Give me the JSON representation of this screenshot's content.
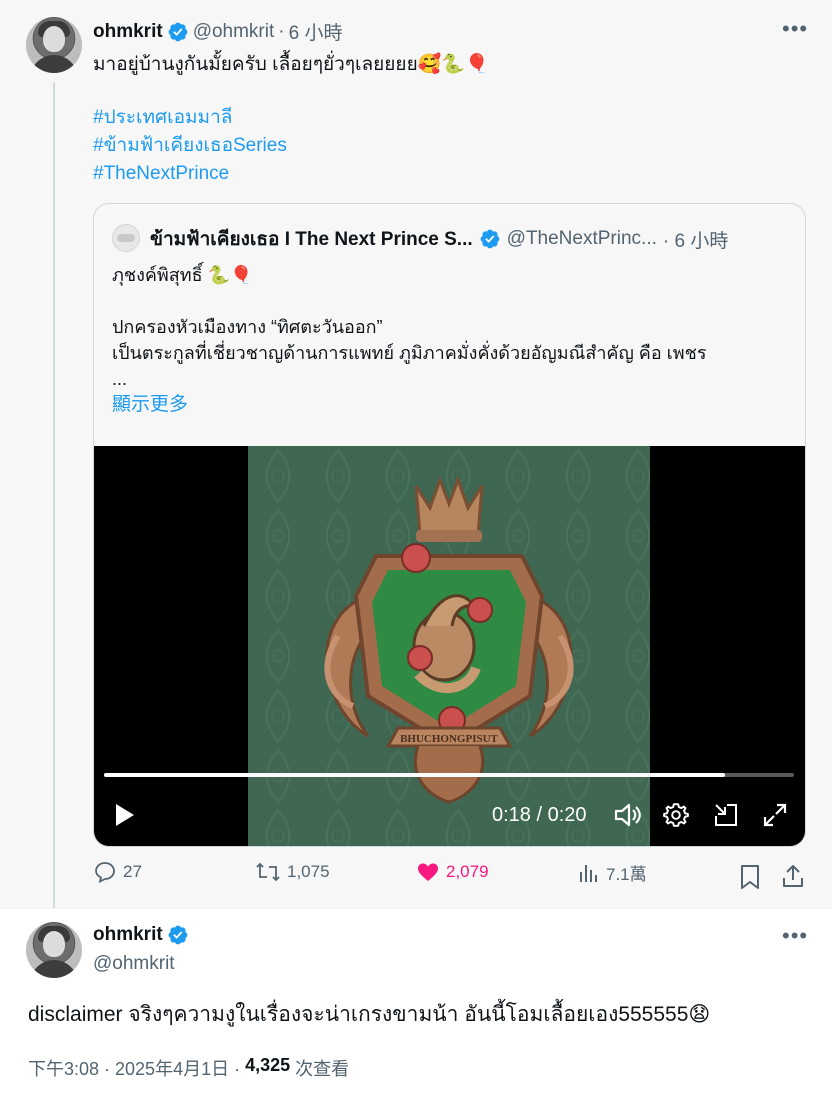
{
  "tweet": {
    "author_name": "ohmkrit",
    "author_handle": "@ohmkrit",
    "time_sep": "·",
    "time": "6 小時",
    "text": "มาอยู่บ้านงูกันมั้ยครับ เลื้อยๆยั่วๆเลยยยย🥰🐍🎈",
    "hashtags": [
      "#ประเทศเอมมาลี",
      "#ข้ามฟ้าเคียงเธอSeries",
      "#TheNextPrince"
    ],
    "quote": {
      "author_name": "ข้ามฟ้าเคียงเธอ I The Next Prince S...",
      "author_handle": "@TheNextPrinc...",
      "time": "· 6 小時",
      "line1": "ภุชงค์พิสุทธิ์ 🐍🎈",
      "line2": "ปกครองหัวเมืองทาง “ทิศตะวันออก”",
      "line3": "เป็นตระกูลที่เชี่ยวชาญด้านการแพทย์ ภูมิภาคมั่งคั่งด้วยอัญมณีสำคัญ คือ เพชร",
      "ellipsis": "...",
      "show_more": "顯示更多",
      "video": {
        "time_display": "0:18 / 0:20",
        "progress": 0.9,
        "crest_banner": "BHUCHONGPISUT"
      }
    },
    "actions": {
      "replies": "27",
      "retweets": "1,075",
      "likes": "2,079",
      "views": "7.1萬"
    }
  },
  "reply": {
    "author_name": "ohmkrit",
    "author_handle": "@ohmkrit",
    "text": "disclaimer จริงๆความงูในเรื่องจะน่าเกรงขามน้า อันนี้โอมเลื้อยเอง555555😧",
    "meta_time": "下午3:08 · 2025年4月1日 ·",
    "views_count": "4,325",
    "views_label": "次查看"
  },
  "colors": {
    "accent": "#1d9bf0",
    "like": "#f91880",
    "muted": "#536471"
  }
}
